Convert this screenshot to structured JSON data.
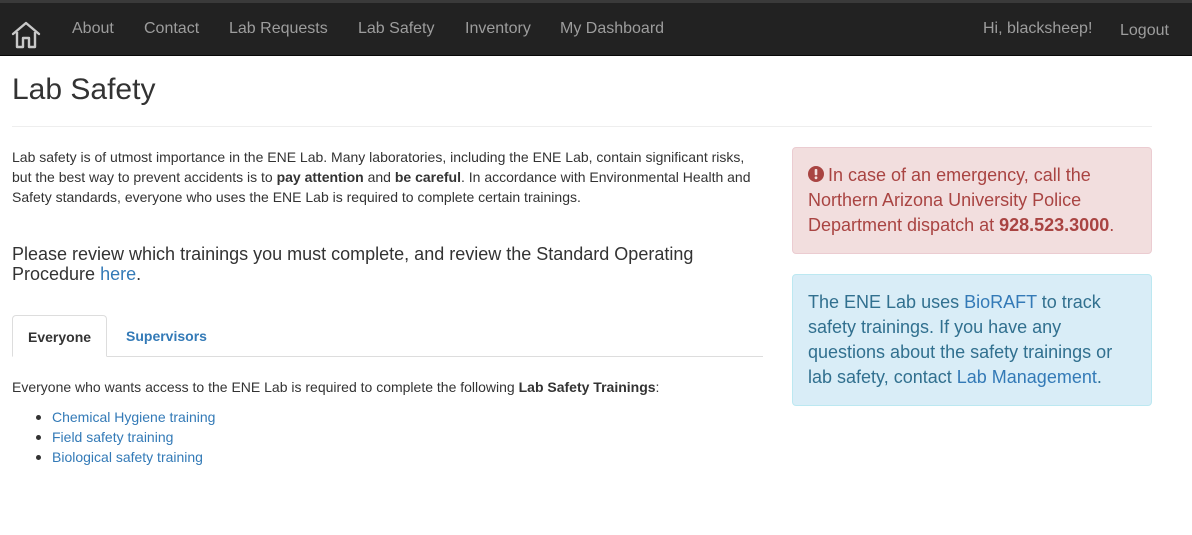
{
  "nav": {
    "home_icon": "home-icon",
    "items": [
      "About",
      "Contact",
      "Lab Requests",
      "Lab Safety",
      "Inventory",
      "My Dashboard"
    ],
    "greeting": "Hi, blacksheep!",
    "logout": "Logout"
  },
  "page": {
    "title": "Lab Safety",
    "intro": {
      "part1": "Lab safety is of utmost importance in the ENE Lab. Many laboratories, including the ENE Lab, contain significant risks, but the best way to prevent accidents is to ",
      "bold1": "pay attention",
      "part2": " and ",
      "bold2": "be careful",
      "part3": ". In accordance with Environmental Health and Safety standards, everyone who uses the ENE Lab is required to complete certain trainings."
    },
    "review": {
      "text": "Please review which trainings you must complete, and review the Standard Operating Procedure ",
      "link": "here",
      "end": "."
    },
    "tabs": [
      "Everyone",
      "Supervisors"
    ],
    "everyone": {
      "text": "Everyone who wants access to the ENE Lab is required to complete the following ",
      "bold": "Lab Safety Trainings",
      "end": ":",
      "trainings": [
        "Chemical Hygiene training",
        "Field safety training",
        "Biological safety training"
      ]
    }
  },
  "alerts": {
    "emergency": {
      "icon": "exclamation-circle-icon",
      "text": "In case of an emergency, call the Northern Arizona University Police Department dispatch at ",
      "phone": "928.523.3000",
      "end": "."
    },
    "info": {
      "part1": "The ENE Lab uses ",
      "link1": "BioRAFT",
      "part2": " to track safety trainings. If you have any questions about the safety trainings or lab safety, contact ",
      "link2": "Lab Management",
      "end": "."
    }
  },
  "colors": {
    "navbar": "#222222",
    "link": "#337ab7",
    "danger_bg": "#f2dede",
    "danger_text": "#a94442",
    "info_bg": "#d9edf7",
    "info_text": "#31708f"
  }
}
